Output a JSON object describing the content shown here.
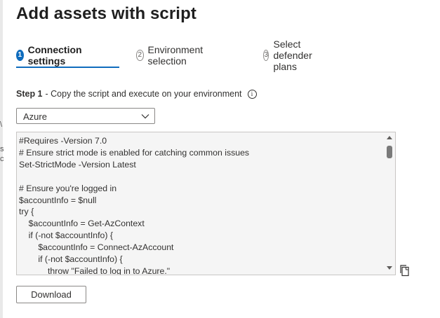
{
  "page": {
    "title": "Add assets with script"
  },
  "steps": [
    {
      "number": "1",
      "label": "Connection settings",
      "active": true
    },
    {
      "number": "2",
      "label": "Environment selection",
      "active": false
    },
    {
      "number": "3",
      "label": "Select defender plans",
      "active": false
    }
  ],
  "instruction": {
    "step_label": "Step 1",
    "text": "- Copy the script and execute on your environment",
    "icon": "info-icon"
  },
  "environment_dropdown": {
    "selected": "Azure",
    "icon": "chevron-down-icon"
  },
  "script": {
    "lines": "#Requires -Version 7.0\n# Ensure strict mode is enabled for catching common issues\nSet-StrictMode -Version Latest\n\n# Ensure you're logged in\n$accountInfo = $null\ntry {\n    $accountInfo = Get-AzContext\n    if (-not $accountInfo) {\n        $accountInfo = Connect-AzAccount\n        if (-not $accountInfo) {\n            throw \"Failed to log in to Azure.\"\n        }\n    }"
  },
  "copy_button": {
    "icon": "copy-icon"
  },
  "download_button": {
    "label": "Download"
  },
  "colors": {
    "accent": "#0f6cbd",
    "border": "#8a8886",
    "script_background": "#f5f5f5"
  }
}
